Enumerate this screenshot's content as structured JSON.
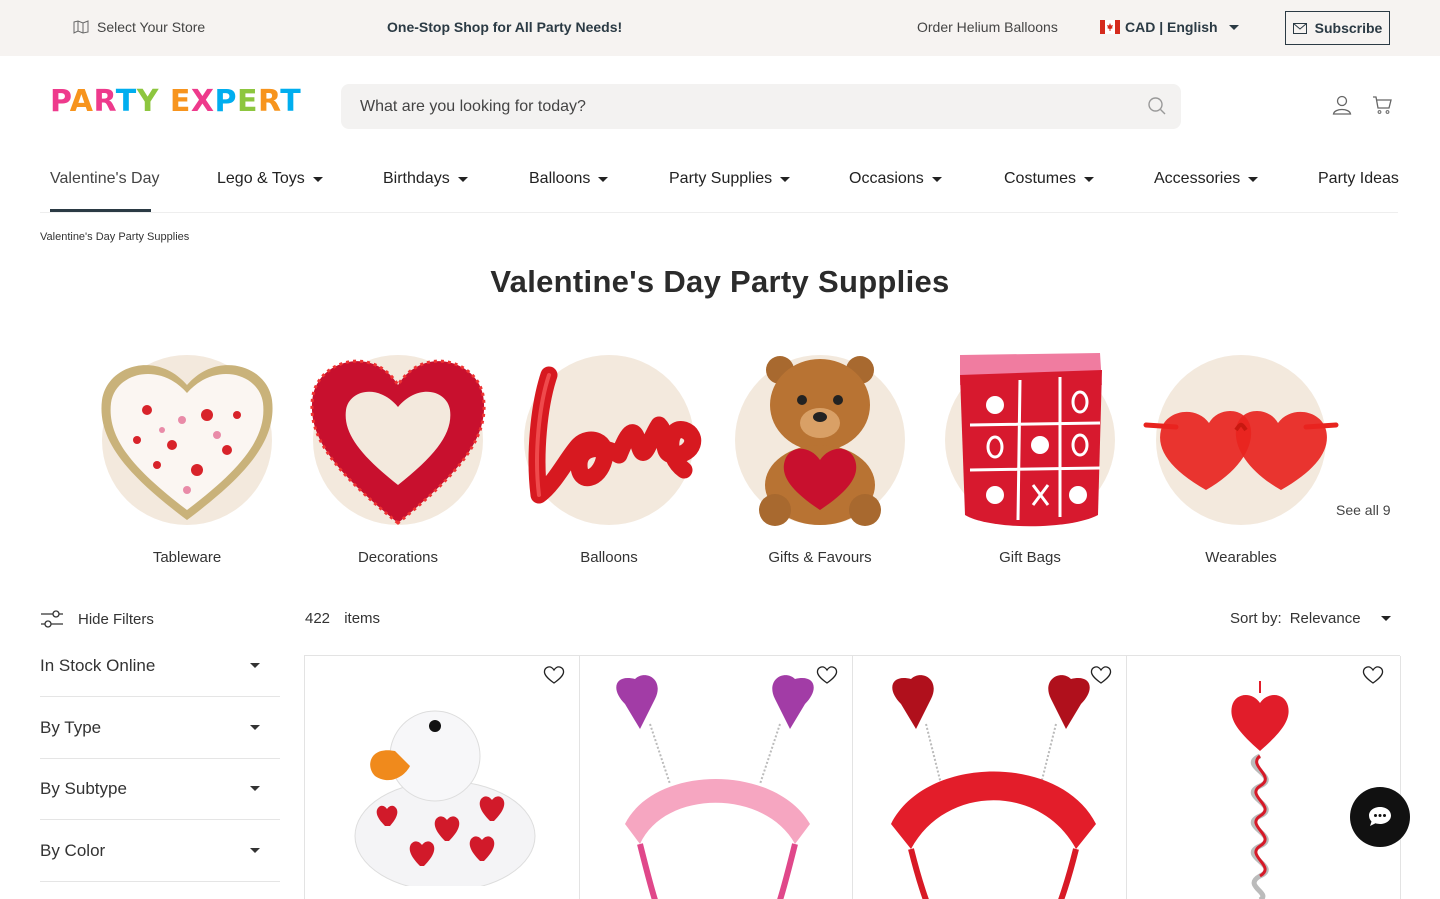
{
  "topbar": {
    "store_label": "Select Your Store",
    "promo": "One-Stop Shop for All Party Needs!",
    "helium_link": "Order Helium Balloons",
    "locale": "CAD | English",
    "subscribe_label": "Subscribe"
  },
  "logo": {
    "letters": [
      "P",
      "A",
      "R",
      "T",
      "Y",
      " ",
      "E",
      "X",
      "P",
      "E",
      "R",
      "T"
    ],
    "colors": [
      "#ee3a8c",
      "#f7941d",
      "#ee3a8c",
      "#00aeef",
      "#8dc63f",
      "#ffffff",
      "#f7941d",
      "#ee3a8c",
      "#00aeef",
      "#8dc63f",
      "#f7941d",
      "#00aeef"
    ]
  },
  "search": {
    "placeholder": "What are you looking for today?"
  },
  "nav": {
    "items": [
      {
        "label": "Valentine's Day"
      },
      {
        "label": "Lego & Toys"
      },
      {
        "label": "Birthdays"
      },
      {
        "label": "Balloons"
      },
      {
        "label": "Party Supplies"
      },
      {
        "label": "Occasions"
      },
      {
        "label": "Costumes"
      },
      {
        "label": "Accessories"
      },
      {
        "label": "Party Ideas"
      }
    ]
  },
  "breadcrumb": "Valentine's Day Party Supplies",
  "page_title": "Valentine's Day Party Supplies",
  "categories": [
    {
      "label": "Tableware"
    },
    {
      "label": "Decorations"
    },
    {
      "label": "Balloons"
    },
    {
      "label": "Gifts & Favours"
    },
    {
      "label": "Gift Bags"
    },
    {
      "label": "Wearables"
    }
  ],
  "see_all": "See all 9",
  "filters": {
    "hide_label": "Hide Filters",
    "groups": [
      {
        "label": "In Stock Online"
      },
      {
        "label": "By Type"
      },
      {
        "label": "By Subtype"
      },
      {
        "label": "By Color"
      }
    ]
  },
  "results": {
    "count": "422",
    "unit": "items"
  },
  "sort": {
    "label": "Sort by:",
    "value": "Relevance"
  },
  "products": [
    {
      "icon": "heart-rubber-duck"
    },
    {
      "icon": "pink-heart-headband"
    },
    {
      "icon": "red-heart-headband"
    },
    {
      "icon": "heart-swirl-decoration"
    }
  ],
  "colors": {
    "accent": "#2b3a44",
    "topbar_bg": "#f6f3f1",
    "category_bg": "#f3e9dd"
  }
}
